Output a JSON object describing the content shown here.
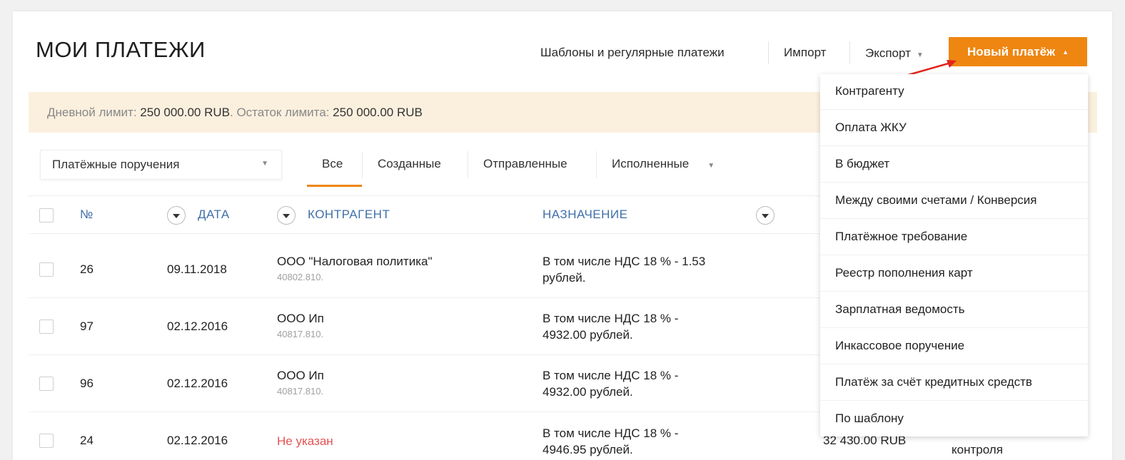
{
  "page": {
    "title": "МОИ ПЛАТЕЖИ"
  },
  "topnav": {
    "templates": "Шаблоны и регулярные платежи",
    "import": "Импорт",
    "export": "Экспорт",
    "new_payment": "Новый платёж",
    "accent_color": "#ee8611"
  },
  "limit": {
    "daily_label": "Дневной лимит:",
    "daily_value": "250 000.00 RUB",
    "remain_label": "Остаток лимита:",
    "remain_value": "250 000.00 RUB"
  },
  "filter": {
    "doc_type": "Платёжные поручения",
    "tabs": [
      "Все",
      "Созданные",
      "Отправленные",
      "Исполненные"
    ]
  },
  "table": {
    "headers": {
      "num": "№",
      "date": "ДАТА",
      "counterparty": "КОНТРАГЕНТ",
      "purpose": "НАЗНАЧЕНИЕ"
    },
    "rows": [
      {
        "num": "26",
        "date": "09.11.2018",
        "counterparty": "ООО \"Налоговая политика\"",
        "account": "40802.810.",
        "purpose_1": "В том числе НДС 18 % - 1.53",
        "purpose_2": "рублей."
      },
      {
        "num": "97",
        "date": "02.12.2016",
        "counterparty": "ООО Ип",
        "account": "40817.810.",
        "purpose_1": "В том числе НДС 18 % -",
        "purpose_2": "4932.00 рублей."
      },
      {
        "num": "96",
        "date": "02.12.2016",
        "counterparty": "ООО Ип",
        "account": "40817.810.",
        "purpose_1": "В том числе НДС 18 % -",
        "purpose_2": "4932.00 рублей."
      },
      {
        "num": "24",
        "date": "02.12.2016",
        "counterparty": "Не указан",
        "account": "",
        "purpose_1": "В том числе НДС 18 % -",
        "purpose_2": "4946.95 рублей.",
        "amount": "32 430.00 RUB",
        "status": "контроля"
      }
    ]
  },
  "dropdown": {
    "items": [
      "Контрагенту",
      "Оплата ЖКУ",
      "В бюджет",
      "Между своими счетами / Конверсия",
      "Платёжное требование",
      "Реестр пополнения карт",
      "Зарплатная ведомость",
      "Инкассовое поручение",
      "Платёж за счёт кредитных средств",
      "По шаблону"
    ]
  }
}
